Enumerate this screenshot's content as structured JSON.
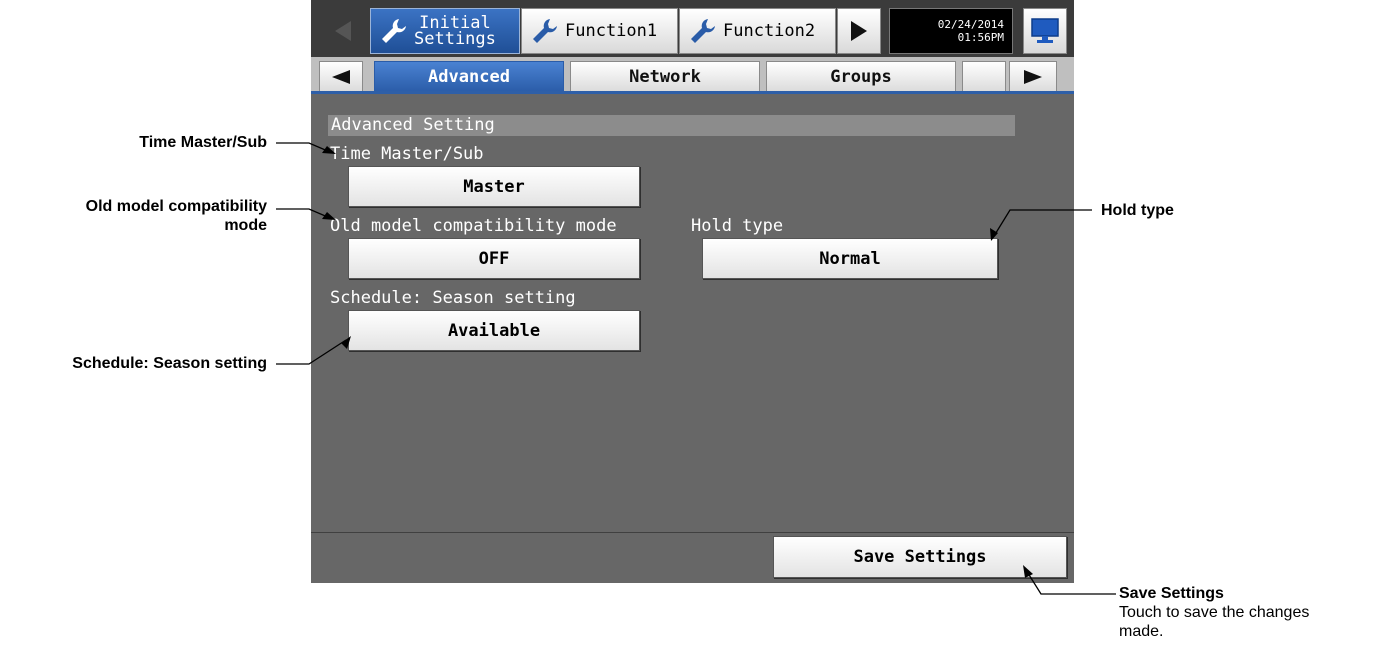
{
  "topbar": {
    "back_label": "◀",
    "tabs": [
      {
        "label_line1": "Initial",
        "label_line2": "Settings",
        "icon": "wrench-icon",
        "active": true
      },
      {
        "label": "Function1",
        "icon": "wrench-icon"
      },
      {
        "label": "Function2",
        "icon": "wrench-icon"
      }
    ],
    "forward_label": "▶",
    "date": "02/24/2014",
    "time": "01:56PM",
    "monitor_icon": "monitor-icon"
  },
  "subtabs": {
    "prev_label": "◀",
    "items": [
      "Advanced",
      "Network",
      "Groups"
    ],
    "active": "Advanced",
    "next_label": "▶"
  },
  "section": {
    "title": "Advanced Setting"
  },
  "fields": {
    "time_master": {
      "label": "Time Master/Sub",
      "value": "Master"
    },
    "old_model": {
      "label": "Old model compatibility mode",
      "value": "OFF"
    },
    "hold_type": {
      "label": "Hold type",
      "value": "Normal"
    },
    "season": {
      "label": "Schedule: Season setting",
      "value": "Available"
    }
  },
  "save_button": "Save Settings",
  "callouts": {
    "time_master": "Time Master/Sub",
    "old_model_line1": "Old model compatibility",
    "old_model_line2": "mode",
    "season": "Schedule: Season setting",
    "hold_type": "Hold type",
    "save_title": "Save Settings",
    "save_desc_line1": "Touch to save the changes",
    "save_desc_line2": "made."
  },
  "colors": {
    "screen_bg": "#676767",
    "active_tab": "#2a5ca8",
    "topbar_bg": "#3b3b3b"
  }
}
